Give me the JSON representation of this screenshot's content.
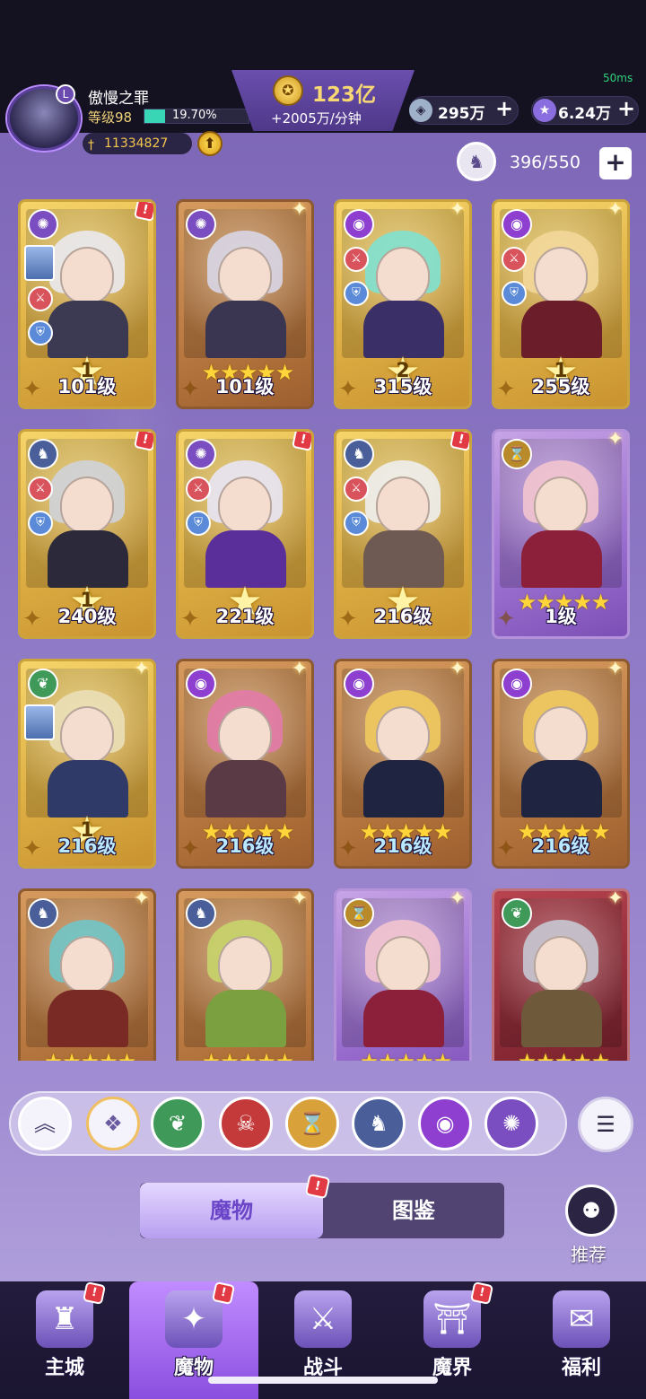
{
  "status": {
    "fps": "50ms"
  },
  "player": {
    "name": "傲慢之罪",
    "level": "等级98",
    "exp_percent": "19.70%",
    "exp_fraction": 0.197,
    "power": "11334827",
    "avatar_badge": "L"
  },
  "gold": {
    "amount": "123亿",
    "rate": "+2005万/分钟"
  },
  "resources": [
    {
      "icon": "gem-icon",
      "value": "295万"
    },
    {
      "icon": "star-crystal-icon",
      "value": "6.24万"
    }
  ],
  "capacity": {
    "value": "396/550"
  },
  "monsters": [
    {
      "faction_icon": "swirl",
      "rank": "1",
      "stars": "",
      "level": "101级",
      "frame": "gold",
      "level_color": "white",
      "hair": "#e9e9f0",
      "body": "#3b3a52",
      "fc": "#7a4ec0",
      "alert": true,
      "atk": true,
      "def": true,
      "portrait": true
    },
    {
      "faction_icon": "swirl",
      "rank": "",
      "stars": "★★★★★",
      "level": "101级",
      "frame": "bronze",
      "level_color": "white",
      "hair": "#d8d6e6",
      "body": "#3a3550",
      "fc": "#7a4ec0",
      "alert": false,
      "atk": false,
      "def": false,
      "portrait": false
    },
    {
      "faction_icon": "eye",
      "rank": "2",
      "stars": "",
      "level": "315级",
      "frame": "gold",
      "level_color": "white",
      "hair": "#7fe1d0",
      "body": "#3a2f66",
      "fc": "#8e3fd0",
      "alert": false,
      "atk": true,
      "def": true,
      "portrait": false
    },
    {
      "faction_icon": "eye",
      "rank": "1",
      "stars": "",
      "level": "255级",
      "frame": "gold",
      "level_color": "white",
      "hair": "#f2d79a",
      "body": "#6b1e2a",
      "fc": "#8e3fd0",
      "alert": false,
      "atk": true,
      "def": true,
      "portrait": false
    },
    {
      "faction_icon": "dragon",
      "rank": "1",
      "stars": "",
      "level": "240级",
      "frame": "gold",
      "level_color": "white",
      "hair": "#cfd3da",
      "body": "#2c2a3a",
      "fc": "#4a5f9a",
      "alert": true,
      "atk": true,
      "def": true,
      "portrait": false
    },
    {
      "faction_icon": "swirl",
      "rank": "",
      "stars": "",
      "level": "221级",
      "frame": "gold",
      "level_color": "white",
      "hair": "#e8e4f5",
      "body": "#5b2f9a",
      "fc": "#7a4ec0",
      "alert": true,
      "atk": true,
      "def": true,
      "portrait": false
    },
    {
      "faction_icon": "dragon",
      "rank": "",
      "stars": "",
      "level": "216级",
      "frame": "gold",
      "level_color": "white",
      "hair": "#eeeeee",
      "body": "#6e5a52",
      "fc": "#4a5f9a",
      "alert": true,
      "atk": true,
      "def": true,
      "portrait": false
    },
    {
      "faction_icon": "hourglass",
      "rank": "",
      "stars": "★★★★★",
      "level": "1级",
      "frame": "purple",
      "level_color": "white",
      "hair": "#f3c4cf",
      "body": "#8c1f3a",
      "fc": "#b98a2a",
      "alert": false,
      "atk": false,
      "def": false,
      "portrait": false
    },
    {
      "faction_icon": "leaf",
      "rank": "1",
      "stars": "",
      "level": "216级",
      "frame": "gold",
      "level_color": "blue",
      "hair": "#eadfb8",
      "body": "#2f3a68",
      "fc": "#3f9a5a",
      "alert": false,
      "atk": false,
      "def": false,
      "portrait": true
    },
    {
      "faction_icon": "eye",
      "rank": "",
      "stars": "★★★★★",
      "level": "216级",
      "frame": "bronze",
      "level_color": "blue",
      "hair": "#e27aa8",
      "body": "#5a3a45",
      "fc": "#8e3fd0",
      "alert": false,
      "atk": false,
      "def": false,
      "portrait": false
    },
    {
      "faction_icon": "eye",
      "rank": "",
      "stars": "★★★★★",
      "level": "216级",
      "frame": "bronze",
      "level_color": "blue",
      "hair": "#f0c95e",
      "body": "#1f2440",
      "fc": "#8e3fd0",
      "alert": false,
      "atk": false,
      "def": false,
      "portrait": false
    },
    {
      "faction_icon": "eye",
      "rank": "",
      "stars": "★★★★★",
      "level": "216级",
      "frame": "bronze",
      "level_color": "blue",
      "hair": "#f0c95e",
      "body": "#1f2440",
      "fc": "#8e3fd0",
      "alert": false,
      "atk": false,
      "def": false,
      "portrait": false
    },
    {
      "faction_icon": "dragon",
      "rank": "",
      "stars": "★★★★★",
      "level": "",
      "frame": "bronze",
      "level_color": "white",
      "hair": "#6fc5c8",
      "body": "#7a2a25",
      "fc": "#4a5f9a",
      "alert": false,
      "atk": false,
      "def": false,
      "portrait": false
    },
    {
      "faction_icon": "dragon",
      "rank": "",
      "stars": "★★★★★",
      "level": "",
      "frame": "bronze",
      "level_color": "white",
      "hair": "#c6d46a",
      "body": "#7aa040",
      "fc": "#4a5f9a",
      "alert": false,
      "atk": false,
      "def": false,
      "portrait": false
    },
    {
      "faction_icon": "hourglass",
      "rank": "",
      "stars": "★★★★★",
      "level": "",
      "frame": "purple",
      "level_color": "white",
      "hair": "#f3c4cf",
      "body": "#8c1f3a",
      "fc": "#b98a2a",
      "alert": false,
      "atk": false,
      "def": false,
      "portrait": false
    },
    {
      "faction_icon": "leaf",
      "rank": "",
      "stars": "★★★★★",
      "level": "",
      "frame": "red",
      "level_color": "white",
      "hair": "#c7c7d0",
      "body": "#6e5a3a",
      "fc": "#3f9a5a",
      "alert": false,
      "atk": false,
      "def": false,
      "portrait": false
    }
  ],
  "filters": [
    {
      "name": "collapse",
      "glyph": "︽",
      "color": "#f4f2fa",
      "fg": "#4a4070"
    },
    {
      "name": "all",
      "glyph": "❖",
      "color": "#f4f2fa",
      "fg": "#6a5aa0"
    },
    {
      "name": "leaf",
      "glyph": "❦",
      "color": "#3f9a5a",
      "fg": "#ffffff"
    },
    {
      "name": "demon",
      "glyph": "☠",
      "color": "#c43a3a",
      "fg": "#ffffff"
    },
    {
      "name": "hourglass",
      "glyph": "⌛",
      "color": "#d9a13a",
      "fg": "#ffffff"
    },
    {
      "name": "dragon",
      "glyph": "♞",
      "color": "#4a5f9a",
      "fg": "#ffffff"
    },
    {
      "name": "eye",
      "glyph": "◉",
      "color": "#8e3fd0",
      "fg": "#ffffff"
    },
    {
      "name": "swirl",
      "glyph": "✺",
      "color": "#7a4ec0",
      "fg": "#ffffff"
    }
  ],
  "tabs": {
    "active": "魔物",
    "inactive": "图鉴"
  },
  "recommend": {
    "label": "推荐"
  },
  "nav": [
    {
      "label": "主城",
      "icon": "castle-icon",
      "glyph": "♜",
      "alert": true,
      "active": false
    },
    {
      "label": "魔物",
      "icon": "monster-icon",
      "glyph": "✦",
      "alert": true,
      "active": true
    },
    {
      "label": "战斗",
      "icon": "battle-icon",
      "glyph": "⚔",
      "alert": false,
      "active": false
    },
    {
      "label": "魔界",
      "icon": "portal-icon",
      "glyph": "⛩",
      "alert": true,
      "active": false
    },
    {
      "label": "福利",
      "icon": "chest-icon",
      "glyph": "✉",
      "alert": false,
      "active": false
    }
  ]
}
